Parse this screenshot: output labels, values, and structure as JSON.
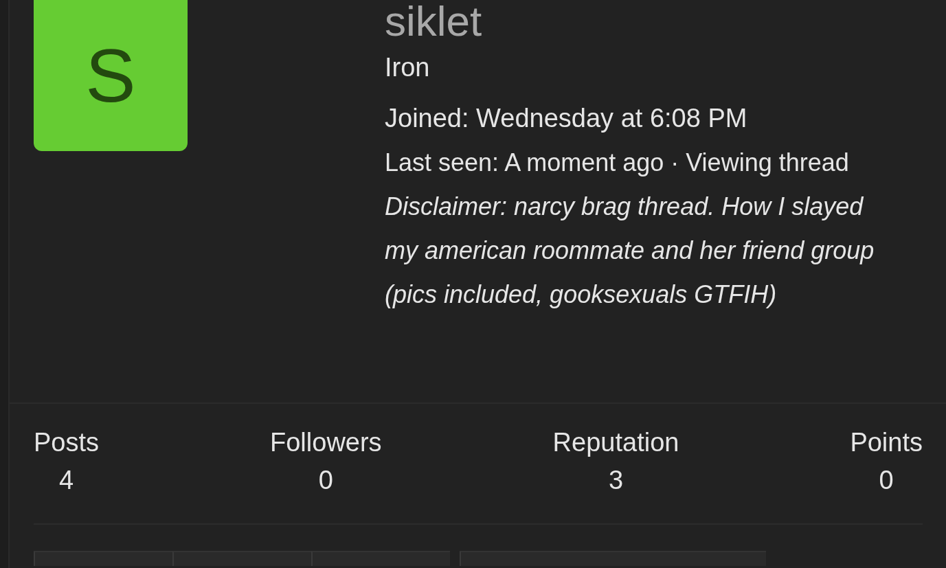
{
  "profile": {
    "avatar_letter": "S",
    "username": "siklet",
    "rank": "Iron",
    "joined": "Joined: Wednesday at 6:08 PM",
    "last_seen": "Last seen: A moment ago · Viewing thread *Disclaimer: narcy brag thread. How I slayed my american roommate and her friend group (pics included, gooksexuals GTFIH)*"
  },
  "stats": [
    {
      "label": "Posts",
      "value": "4"
    },
    {
      "label": "Followers",
      "value": "0"
    },
    {
      "label": "Reputation",
      "value": "3"
    },
    {
      "label": "Points",
      "value": "0"
    }
  ],
  "tabs": [
    {
      "kind": "tab"
    },
    {
      "kind": "tab"
    },
    {
      "kind": "tab"
    },
    {
      "kind": "wide"
    }
  ]
}
